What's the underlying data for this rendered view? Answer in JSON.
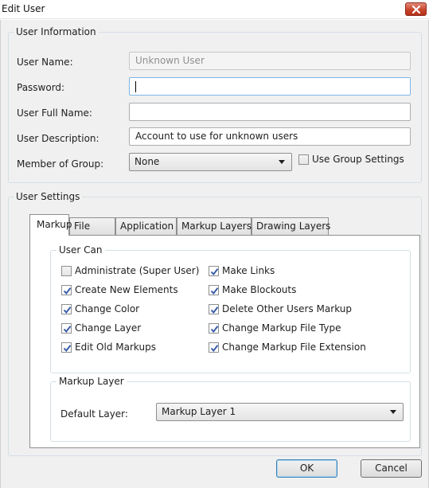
{
  "window": {
    "title": "Edit User"
  },
  "user_information": {
    "group_title": "User Information",
    "user_name": {
      "label": "User Name:",
      "value": "Unknown User"
    },
    "password": {
      "label": "Password:",
      "value": ""
    },
    "full_name": {
      "label": "User Full Name:",
      "value": ""
    },
    "description": {
      "label": "User Description:",
      "value": "Account to use for unknown users"
    },
    "member_of_group": {
      "label": "Member of Group:",
      "value": "None"
    },
    "use_group_settings": {
      "label": "Use Group Settings",
      "checked": false
    }
  },
  "user_settings": {
    "group_title": "User Settings",
    "tabs": [
      {
        "label": "Markup",
        "active": true
      },
      {
        "label": "File",
        "active": false
      },
      {
        "label": "Application",
        "active": false
      },
      {
        "label": "Markup Layers",
        "active": false
      },
      {
        "label": "Drawing Layers",
        "active": false
      }
    ],
    "user_can": {
      "group_title": "User Can",
      "left": [
        {
          "label": "Administrate (Super User)",
          "checked": false
        },
        {
          "label": "Create New Elements",
          "checked": true
        },
        {
          "label": "Change Color",
          "checked": true
        },
        {
          "label": "Change Layer",
          "checked": true
        },
        {
          "label": "Edit Old Markups",
          "checked": true
        }
      ],
      "right": [
        {
          "label": "Make Links",
          "checked": true
        },
        {
          "label": "Make Blockouts",
          "checked": true
        },
        {
          "label": "Delete Other Users Markup",
          "checked": true
        },
        {
          "label": "Change Markup File Type",
          "checked": true
        },
        {
          "label": "Change Markup File Extension",
          "checked": true
        }
      ]
    },
    "markup_layer": {
      "group_title": "Markup Layer",
      "default_layer_label": "Default Layer:",
      "default_layer_value": "Markup Layer 1"
    }
  },
  "buttons": {
    "ok": "OK",
    "cancel": "Cancel"
  },
  "icons": {
    "close": "close-icon",
    "checkmark": "checkmark-icon",
    "dropdown": "chevron-down-icon"
  },
  "colors": {
    "close_button": "#c9452c",
    "checkmark": "#3a5ea8",
    "focus_border": "#7eb4ea"
  }
}
